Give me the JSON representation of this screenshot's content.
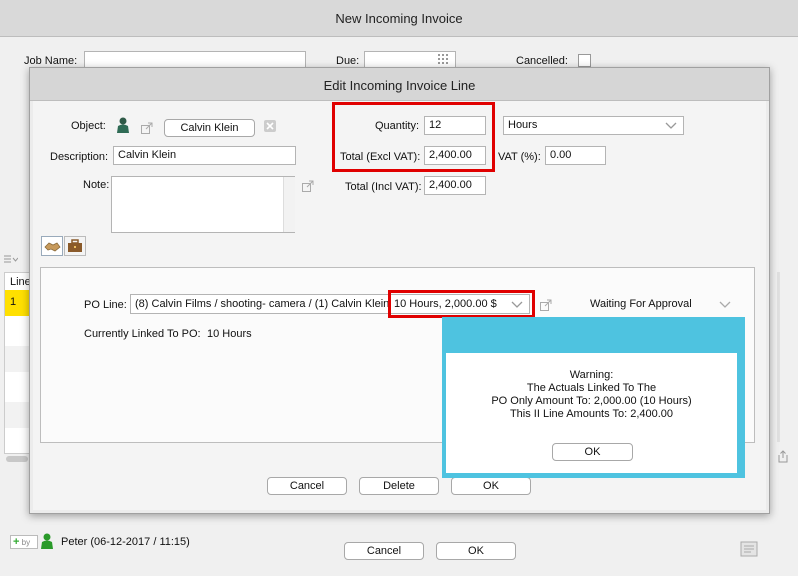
{
  "main_window": {
    "title": "New Incoming Invoice",
    "job_name_label": "Job Name:",
    "job_name_value": "",
    "due_label": "Due:",
    "due_value": "",
    "cancelled_label": "Cancelled:",
    "line_column_header": "Line",
    "line_row_number": "1",
    "created_by_label": "by",
    "created_by_user": "Peter (06-12-2017 / 11:15)",
    "cancel_label": "Cancel",
    "ok_label": "OK"
  },
  "edit_dialog": {
    "title": "Edit Incoming Invoice Line",
    "object_label": "Object:",
    "object_value": "Calvin Klein",
    "description_label": "Description:",
    "description_value": "Calvin Klein",
    "note_label": "Note:",
    "note_value": "",
    "quantity_label": "Quantity:",
    "quantity_value": "12",
    "unit_value": "Hours",
    "total_excl_label": "Total (Excl VAT):",
    "total_excl_value": "2,400.00",
    "vat_label": "VAT (%):",
    "vat_value": "0.00",
    "total_incl_label": "Total (Incl VAT):",
    "total_incl_value": "2,400.00",
    "po_line_label": "PO Line:",
    "po_line_value": "(8) Calvin Films / shooting- camera / (1) Calvin Klein",
    "po_line_amount": "10 Hours, 2,000.00 $",
    "po_status": "Waiting For Approval",
    "linked_label": "Currently Linked To PO:",
    "linked_value": "10 Hours",
    "cancel_label": "Cancel",
    "delete_label": "Delete",
    "ok_label": "OK"
  },
  "warning": {
    "line1": "Warning:",
    "line2": "The Actuals Linked To The",
    "line3": "PO Only Amount To: 2,000.00 (10 Hours)",
    "line4": "This II Line Amounts To: 2,400.00",
    "ok_label": "OK"
  },
  "colors": {
    "highlight_red": "#e00000",
    "warning_cyan": "#4ec3e0",
    "row_yellow": "#ffe000",
    "user_green": "#2a9a2a"
  }
}
